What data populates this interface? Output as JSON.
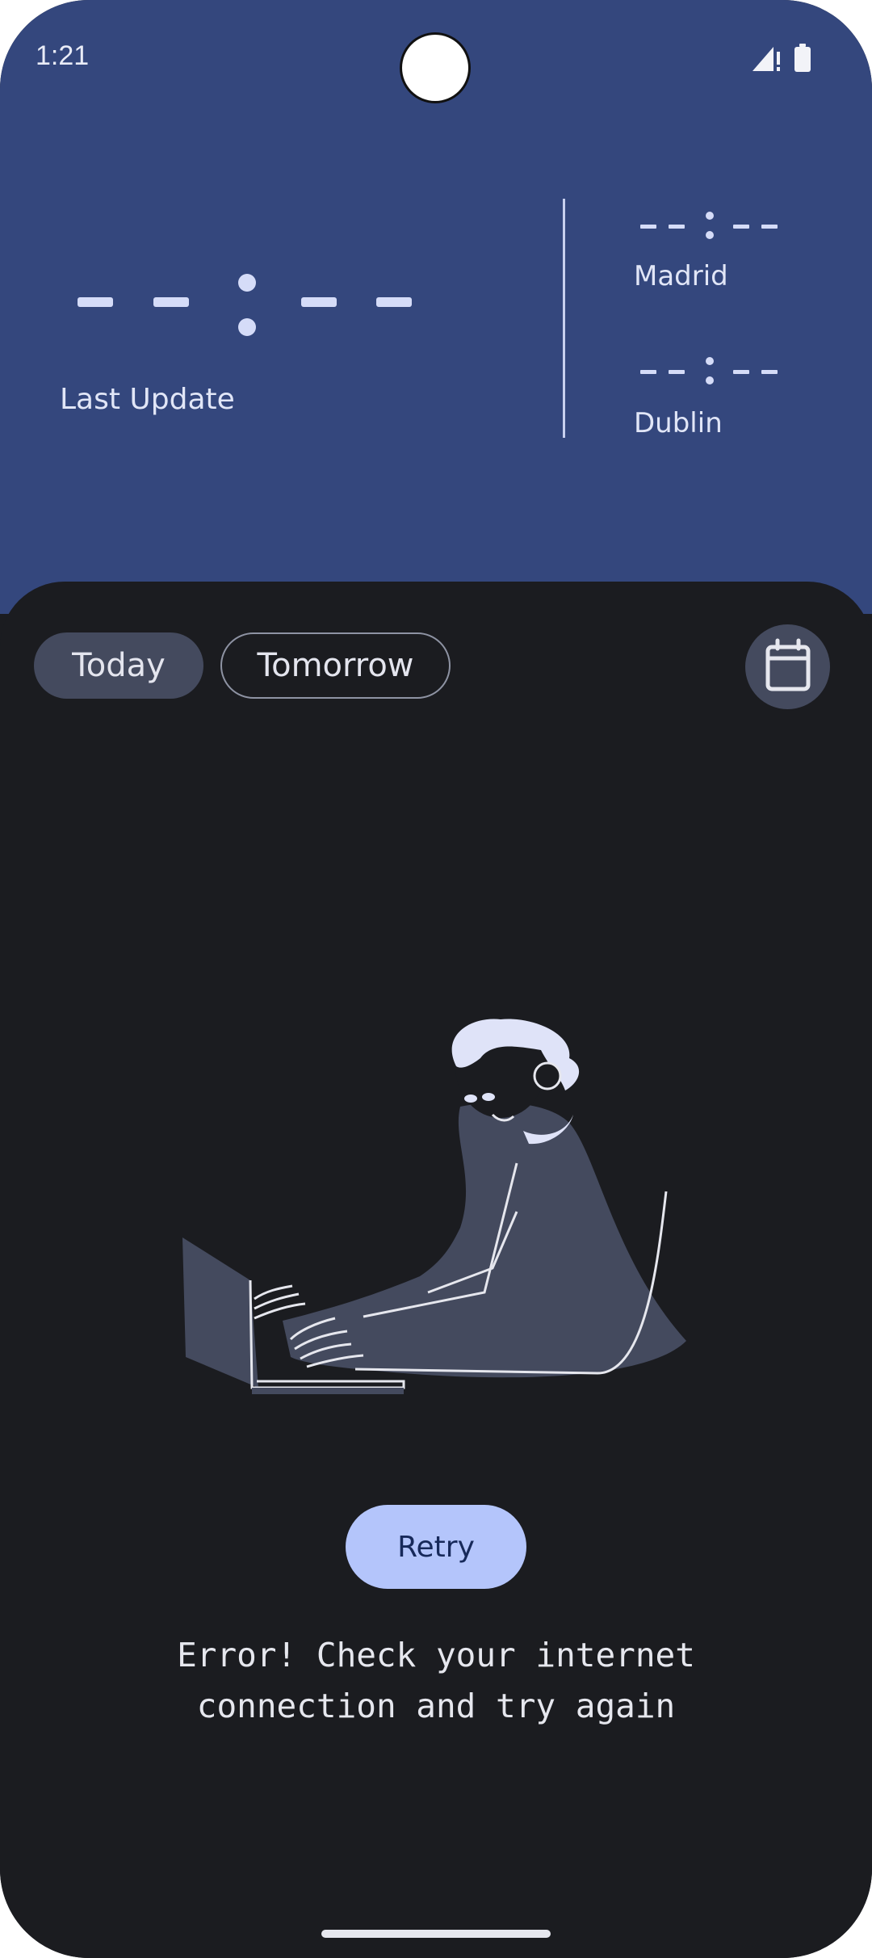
{
  "status_bar": {
    "time": "1:21",
    "icons": [
      "signal-icon",
      "battery-icon"
    ]
  },
  "header": {
    "main_time": "--:--",
    "last_update_label": "Last Update",
    "cities": [
      {
        "time": "--:--",
        "name": "Madrid"
      },
      {
        "time": "--:--",
        "name": "Dublin"
      }
    ]
  },
  "tabs": {
    "today": "Today",
    "tomorrow": "Tomorrow",
    "selected": "Today",
    "calendar_icon": "calendar-icon"
  },
  "error": {
    "illustration": "person-at-laptop-illustration",
    "retry_label": "Retry",
    "message": "Error! Check your internet\nconnection and try again"
  },
  "colors": {
    "header_bg": "#34477d",
    "sheet_bg": "#1b1c20",
    "chip_selected": "#444a5e",
    "accent_button": "#b4c5fb",
    "accent_text": "#17295a",
    "light_text": "#e1e6f7"
  }
}
